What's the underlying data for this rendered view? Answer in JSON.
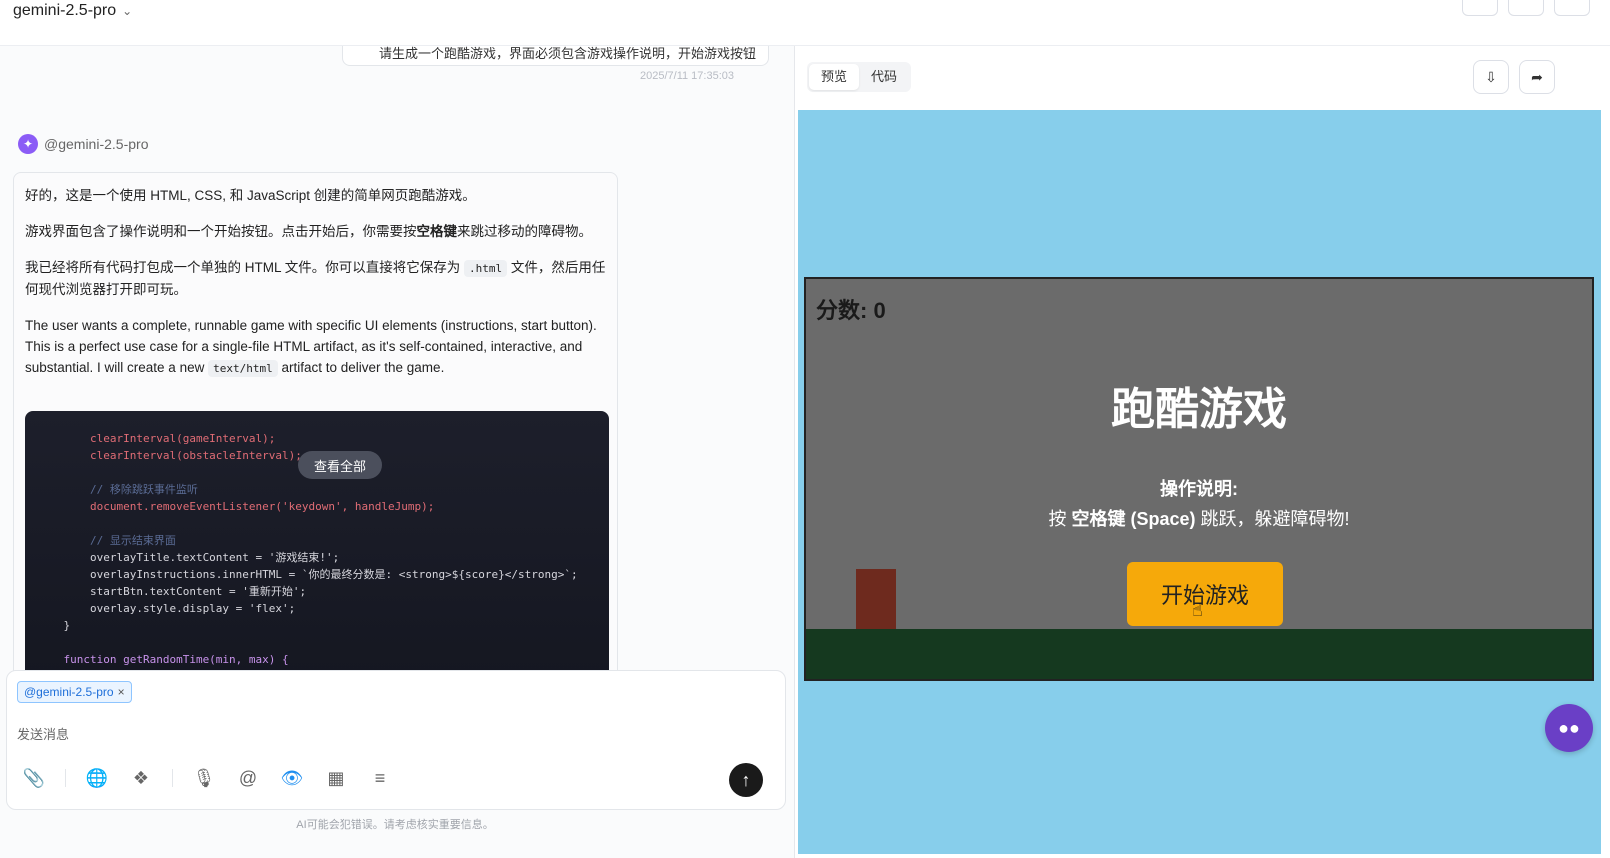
{
  "header": {
    "model_title": "gemini-2.5-pro",
    "chevron": "chevron-down-icon"
  },
  "chat": {
    "user_message": "请生成一个跑酷游戏，界面必须包含游戏操作说明，开始游戏按钮",
    "user_timestamp": "2025/7/11 17:35:03",
    "bot_name": "@gemini-2.5-pro",
    "paragraphs": {
      "p1": "好的，这是一个使用 HTML, CSS, 和 JavaScript 创建的简单网页跑酷游戏。",
      "p2a": "游戏界面包含了操作说明和一个开始按钮。点击开始后，你需要按",
      "p2b": "空格键",
      "p2c": "来跳过移动的障碍物。",
      "p3a": "我已经将所有代码打包成一个单独的 HTML 文件。你可以直接将它保存为",
      "p3code": ".html",
      "p3b": "文件，然后用任何现代浏览器打开即可玩。",
      "p4a": "The user wants a complete, runnable game with specific UI elements (instructions, start button). This is a perfect use case for a single-file HTML artifact, as it's self-contained, interactive, and substantial. I will create a new",
      "p4code": "text/html",
      "p4b": "artifact to deliver the game."
    },
    "view_all_label": "查看全部",
    "code_lines": [
      "        clearInterval(gameInterval);",
      "        clearInterval(obstacleInterval);",
      "",
      "        // 移除跳跃事件监听",
      "        document.removeEventListener('keydown', handleJump);",
      "",
      "        // 显示结束界面",
      "        overlayTitle.textContent = '游戏结束!';",
      "        overlayInstructions.innerHTML = `你的最终分数是: <strong>${score}</strong>`;",
      "        startBtn.textContent = '重新开始';",
      "        overlay.style.display = 'flex';",
      "    }",
      "",
      "    function getRandomTime(min, max) {"
    ]
  },
  "composer": {
    "mention": "@gemini-2.5-pro",
    "placeholder": "发送消息",
    "tools": [
      "paperclip-icon",
      "globe-icon",
      "brain-icon",
      "microphone-icon",
      "at-icon",
      "eye-icon",
      "apps-icon",
      "scan-icon"
    ],
    "disclaimer": "AI可能会犯错误。请考虑核实重要信息。"
  },
  "preview": {
    "tabs": [
      "预览",
      "代码"
    ],
    "active_tab": "预览",
    "download_icon": "download-icon",
    "share_icon": "share-icon"
  },
  "game": {
    "score_label": "分数: 0",
    "title": "跑酷游戏",
    "instructions_heading": "操作说明:",
    "instructions_pre": "按 ",
    "instructions_key": "空格键 (Space)",
    "instructions_post": " 跳跃，躲避障碍物!",
    "start_button": "开始游戏",
    "sky_color": "#87ceeb",
    "ground_color": "#15391f",
    "button_color": "#f6a90a"
  }
}
